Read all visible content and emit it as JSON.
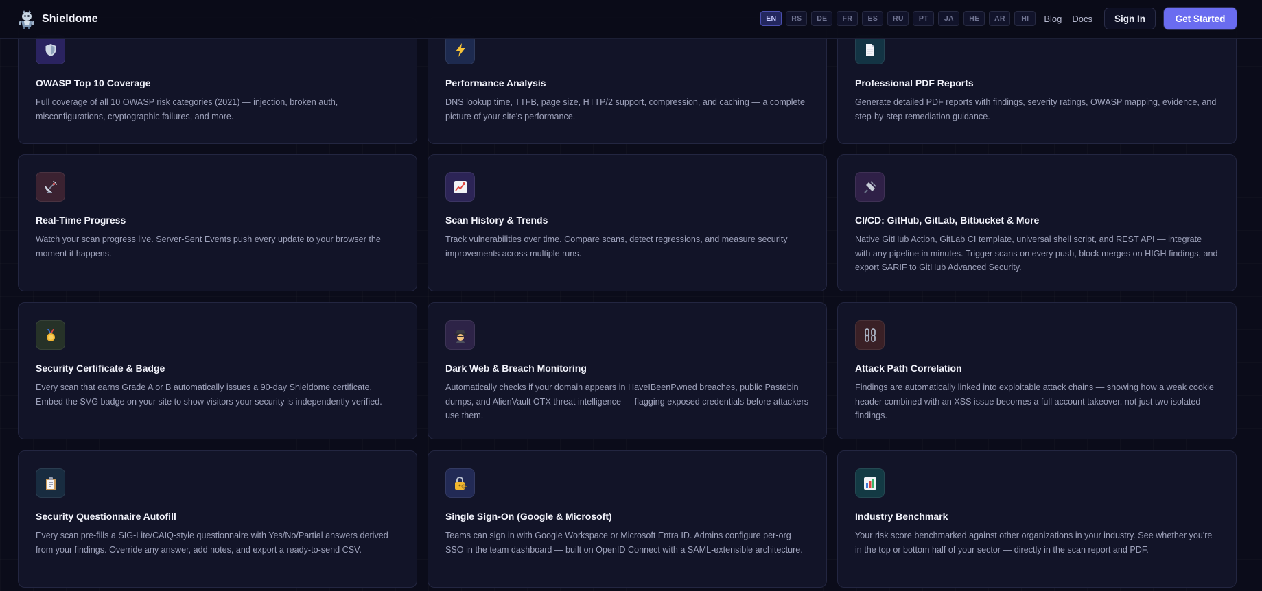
{
  "brand": {
    "name": "Shieldome"
  },
  "nav": {
    "languages": [
      {
        "code": "EN",
        "active": true
      },
      {
        "code": "RS"
      },
      {
        "code": "DE"
      },
      {
        "code": "FR"
      },
      {
        "code": "ES"
      },
      {
        "code": "RU"
      },
      {
        "code": "PT"
      },
      {
        "code": "JA"
      },
      {
        "code": "HE"
      },
      {
        "code": "AR"
      },
      {
        "code": "HI"
      }
    ],
    "blog": "Blog",
    "docs": "Docs",
    "sign_in": "Sign In",
    "get_started": "Get Started"
  },
  "features": [
    {
      "icon": "shield-icon",
      "title": "OWASP Top 10 Coverage",
      "desc": "Full coverage of all 10 OWASP risk categories (2021) — injection, broken auth, misconfigurations, cryptographic failures, and more.",
      "icon_bg": "#2a2360"
    },
    {
      "icon": "lightning-icon",
      "title": "Performance Analysis",
      "desc": "DNS lookup time, TTFB, page size, HTTP/2 support, compression, and caching — a complete picture of your site's performance.",
      "icon_bg": "#1d2a4f"
    },
    {
      "icon": "document-icon",
      "title": "Professional PDF Reports",
      "desc": "Generate detailed PDF reports with findings, severity ratings, OWASP mapping, evidence, and step-by-step remediation guidance.",
      "icon_bg": "#133444"
    },
    {
      "icon": "satellite-icon",
      "title": "Real-Time Progress",
      "desc": "Watch your scan progress live. Server-Sent Events push every update to your browser the moment it happens.",
      "icon_bg": "#3b2231"
    },
    {
      "icon": "chart-up-icon",
      "title": "Scan History & Trends",
      "desc": "Track vulnerabilities over time. Compare scans, detect regressions, and measure security improvements across multiple runs.",
      "icon_bg": "#2c2456"
    },
    {
      "icon": "plug-icon",
      "title": "CI/CD: GitHub, GitLab, Bitbucket & More",
      "desc": "Native GitHub Action, GitLab CI template, universal shell script, and REST API — integrate with any pipeline in minutes. Trigger scans on every push, block merges on HIGH findings, and export SARIF to GitHub Advanced Security.",
      "icon_bg": "#2f2047"
    },
    {
      "icon": "medal-icon",
      "title": "Security Certificate & Badge",
      "desc": "Every scan that earns Grade A or B automatically issues a 90-day Shieldome certificate. Embed the SVG badge on your site to show visitors your security is independently verified.",
      "icon_bg": "#263228"
    },
    {
      "icon": "detective-icon",
      "title": "Dark Web & Breach Monitoring",
      "desc": "Automatically checks if your domain appears in HaveIBeenPwned breaches, public Pastebin dumps, and AlienVault OTX threat intelligence — flagging exposed credentials before attackers use them.",
      "icon_bg": "#2d2347"
    },
    {
      "icon": "chain-icon",
      "title": "Attack Path Correlation",
      "desc": "Findings are automatically linked into exploitable attack chains — showing how a weak cookie header combined with an XSS issue becomes a full account takeover, not just two isolated findings.",
      "icon_bg": "#3a2026"
    },
    {
      "icon": "clipboard-icon",
      "title": "Security Questionnaire Autofill",
      "desc": "Every scan pre-fills a SIG-Lite/CAIQ-style questionnaire with Yes/No/Partial answers derived from your findings. Override any answer, add notes, and export a ready-to-send CSV.",
      "icon_bg": "#182c40"
    },
    {
      "icon": "lock-key-icon",
      "title": "Single Sign-On (Google & Microsoft)",
      "desc": "Teams can sign in with Google Workspace or Microsoft Entra ID. Admins configure per-org SSO in the team dashboard — built on OpenID Connect with a SAML-extensible architecture.",
      "icon_bg": "#222a55"
    },
    {
      "icon": "bar-chart-icon",
      "title": "Industry Benchmark",
      "desc": "Your risk score benchmarked against other organizations in your industry. See whether you're in the top or bottom half of your sector — directly in the scan report and PDF.",
      "icon_bg": "#133a44"
    }
  ]
}
